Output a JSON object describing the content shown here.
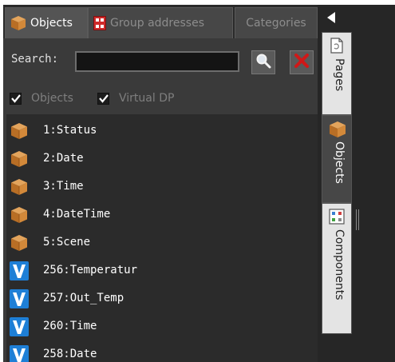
{
  "tabs": {
    "objects": "Objects",
    "group_addresses": "Group addresses",
    "categories": "Categories"
  },
  "search": {
    "label": "Search:",
    "value": "",
    "placeholder": ""
  },
  "filters": {
    "objects": {
      "label": "Objects",
      "checked": true
    },
    "virtual_dp": {
      "label": "Virtual DP",
      "checked": true
    }
  },
  "items": [
    {
      "label": "1:Status",
      "icon": "object-cube-icon"
    },
    {
      "label": "2:Date",
      "icon": "object-cube-icon"
    },
    {
      "label": "3:Time",
      "icon": "object-cube-icon"
    },
    {
      "label": "4:DateTime",
      "icon": "object-cube-icon"
    },
    {
      "label": "5:Scene",
      "icon": "object-cube-icon"
    },
    {
      "label": "256:Temperatur",
      "icon": "virtual-dp-icon"
    },
    {
      "label": "257:Out_Temp",
      "icon": "virtual-dp-icon"
    },
    {
      "label": "260:Time",
      "icon": "virtual-dp-icon"
    },
    {
      "label": "258:Date",
      "icon": "virtual-dp-icon"
    }
  ],
  "side_tabs": {
    "pages": "Pages",
    "objects": "Objects",
    "components": "Components"
  },
  "colors": {
    "panel_bg": "#3a3a3a",
    "list_bg": "#2b2b2b",
    "cube_orange": "#c8853a",
    "virtual_blue": "#1e7fd6",
    "clear_red": "#d01818"
  }
}
